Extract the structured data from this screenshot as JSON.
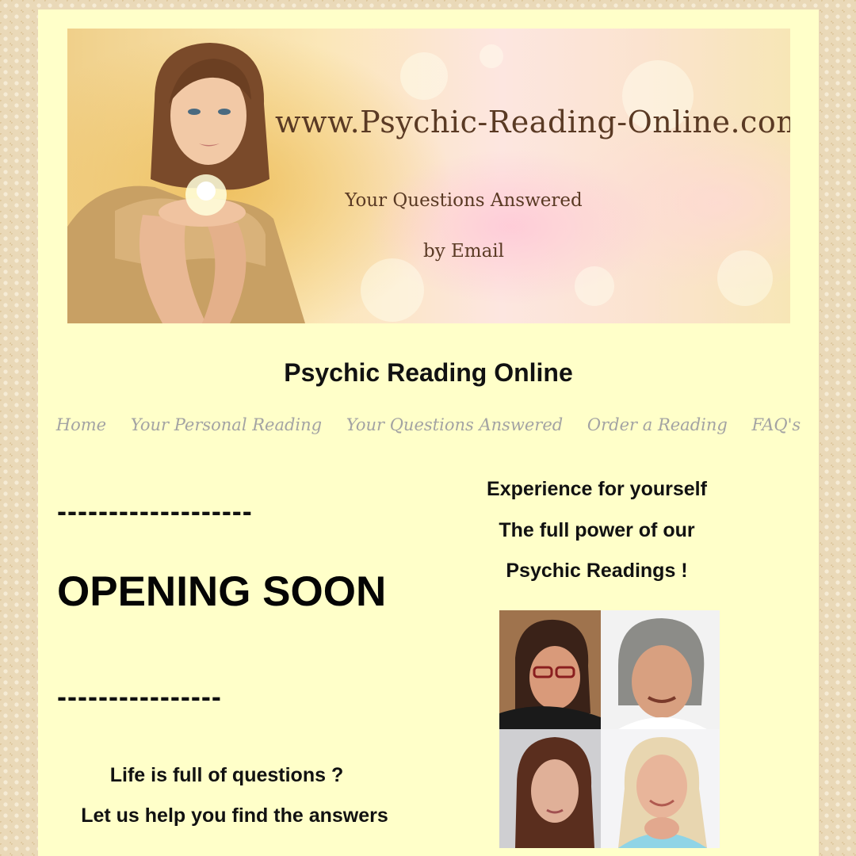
{
  "banner": {
    "site_url": "www.Psychic-Reading-Online.com",
    "line1": "Your Questions Answered",
    "line2": "by Email"
  },
  "site_title": "Psychic Reading Online",
  "nav": {
    "items": [
      {
        "label": "Home"
      },
      {
        "label": "Your Personal Reading"
      },
      {
        "label": "Your Questions Answered"
      },
      {
        "label": "Order a Reading"
      },
      {
        "label": "FAQ's"
      }
    ]
  },
  "left": {
    "dashes_top": "-------------------",
    "headline": "OPENING SOON",
    "dashes_bottom": "----------------",
    "question": "Life is full of questions ?",
    "help": "Let us help you find the answers"
  },
  "right": {
    "line1": "Experience for yourself",
    "line2": "The full power of our",
    "line3": "Psychic Readings !"
  },
  "colors": {
    "page_bg": "#ffffc9",
    "nav_text": "#a3a3a3",
    "banner_text": "#5a3a24"
  }
}
